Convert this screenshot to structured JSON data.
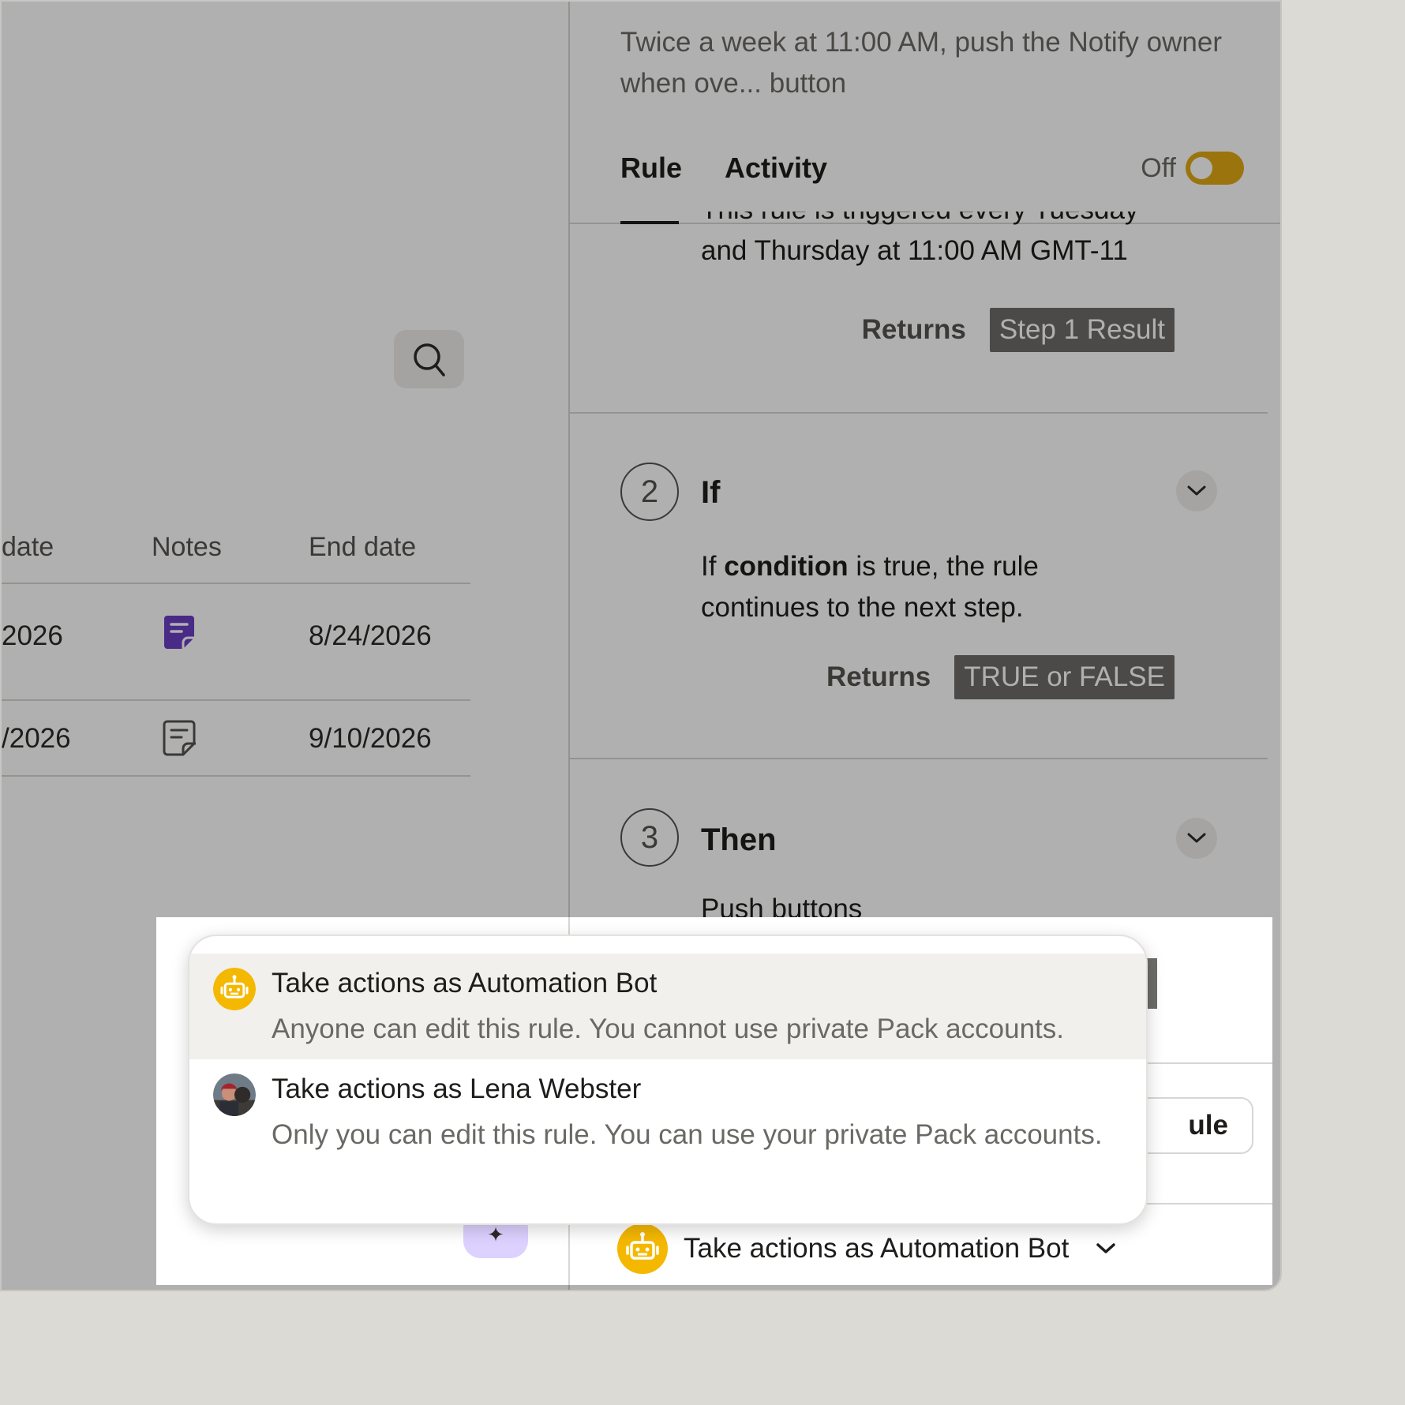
{
  "rule_panel": {
    "description": "Twice a week at 11:00 AM, push the Notify owner when ove... button",
    "tabs": [
      {
        "label": "Rule"
      },
      {
        "label": "Activity"
      }
    ],
    "toggle": {
      "label": "Off",
      "state": "off",
      "color": "#e3a914"
    },
    "step1": {
      "text_line1": "This rule is triggered every Tuesday",
      "text_line2": "and Thursday at 11:00 AM GMT-11",
      "returns_label": "Returns",
      "returns_value": "Step 1 Result"
    },
    "step2": {
      "number": "2",
      "title": "If",
      "body_pre": "If ",
      "body_bold": "condition",
      "body_post": " is true, the rule continues to the next step.",
      "returns_label": "Returns",
      "returns_value": "TRUE or FALSE"
    },
    "step3": {
      "number": "3",
      "title": "Then",
      "body": "Push buttons"
    },
    "partial_button_label": "ule",
    "actor_select": {
      "label": "Take actions as Automation Bot"
    }
  },
  "table": {
    "headers": [
      "date",
      "Notes",
      "End date"
    ],
    "rows": [
      {
        "start": "2026",
        "end": "8/24/2026",
        "note_icon": "note-filled-icon"
      },
      {
        "start": "/2026",
        "end": "9/10/2026",
        "note_icon": "note-outline-icon"
      }
    ]
  },
  "actor_menu": {
    "options": [
      {
        "title": "Take actions as Automation Bot",
        "desc": "Anyone can edit this rule. You cannot use private Pack accounts.",
        "icon": "robot-icon",
        "highlighted": true
      },
      {
        "title": "Take actions as Lena Webster",
        "desc": "Only you can edit this rule. You can use your private Pack accounts.",
        "icon": "user-avatar"
      }
    ]
  },
  "colors": {
    "accent_yellow": "#f5b800",
    "note_purple": "#6b3fc4",
    "ai_button": "#ddd1ff"
  }
}
